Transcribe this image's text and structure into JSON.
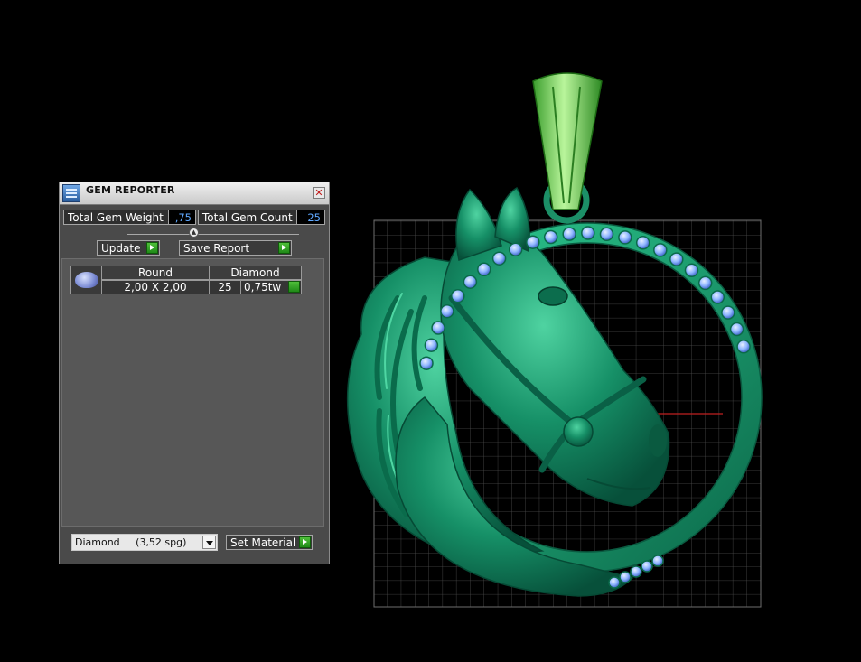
{
  "panel": {
    "title": "GEM REPORTER",
    "close_glyph": "✕",
    "total_gem_weight_label": "Total Gem Weight",
    "total_gem_weight_value": ",75",
    "total_gem_count_label": "Total Gem Count",
    "total_gem_count_value": "25",
    "update_label": "Update",
    "save_report_label": "Save Report",
    "table": {
      "headers": [
        "Round",
        "Diamond"
      ],
      "row": {
        "size": "2,00 X 2,00",
        "count": "25",
        "weight": "0,75tw"
      }
    },
    "material_select_value": "Diamond     (3,52 spg)",
    "set_material_label": "Set Material"
  },
  "colors": {
    "model_green": "#1f9a6e",
    "bail_green": "#6fd85a",
    "gem_blue": "#8fb6ff",
    "value_text": "#5fa8ff",
    "grid_line": "#5a5a5a"
  },
  "icons": {
    "app": "gem-reporter-app-icon",
    "close": "close-icon",
    "go": "green-arrow-icon",
    "dropdown": "chevron-down-icon",
    "gem": "round-gem-icon"
  }
}
